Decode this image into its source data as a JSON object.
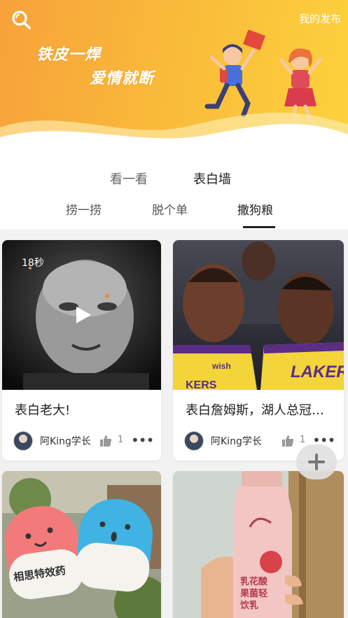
{
  "header": {
    "my_posts": "我的发布",
    "slogan_line1": "铁皮一焊",
    "slogan_line2": "爱情就断",
    "accent": "#fcd23c"
  },
  "main_tabs": [
    {
      "label": "看一看",
      "active": false
    },
    {
      "label": "表白墙",
      "active": true
    }
  ],
  "sub_tabs": [
    {
      "label": "捞一捞",
      "active": false
    },
    {
      "label": "脱个单",
      "active": false
    },
    {
      "label": "撒狗粮",
      "active": true
    }
  ],
  "cards": [
    {
      "title": "表白老大!",
      "author": "阿King学长",
      "likes": "1",
      "duration": "18秒",
      "is_video": true
    },
    {
      "title": "表白詹姆斯，湖人总冠军！",
      "author": "阿King学长",
      "likes": "1",
      "is_video": false
    },
    {
      "title": "",
      "author": "",
      "likes": "",
      "is_video": false,
      "image_text": "相思特效药"
    },
    {
      "title": "",
      "author": "",
      "likes": "",
      "is_video": false,
      "image_text": "乳花酸果菌轻饮乳"
    }
  ]
}
